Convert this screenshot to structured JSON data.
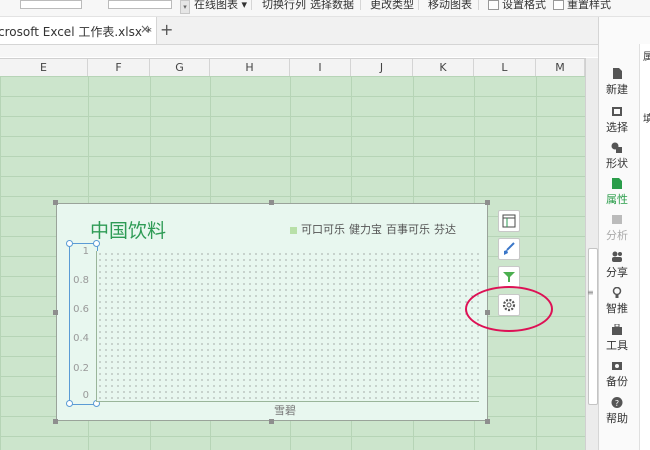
{
  "ribbon": {
    "online_chart": "在线图表",
    "switch_row_col": "切换行列",
    "select_data": "选择数据",
    "change_type": "更改类型",
    "move_chart": "移动图表",
    "set_format": "设置格式",
    "reset_style": "重置样式"
  },
  "tabs": {
    "file_title": "crosoft Excel 工作表.xlsx *",
    "close": "×",
    "add": "+"
  },
  "columns": [
    "E",
    "F",
    "G",
    "H",
    "I",
    "J",
    "K",
    "L",
    "M"
  ],
  "chart": {
    "title": "中国饮料",
    "legend": [
      "可口可乐",
      "健力宝",
      "百事可乐",
      "芬达"
    ],
    "yticks": [
      "1",
      "0.8",
      "0.6",
      "0.4",
      "0.2",
      "0"
    ],
    "xlabel": "雪碧"
  },
  "side_panel": {
    "items": [
      {
        "label": "新建",
        "icon": "new-doc-icon"
      },
      {
        "label": "选择",
        "icon": "select-icon"
      },
      {
        "label": "形状",
        "icon": "shapes-icon"
      },
      {
        "label": "属性",
        "icon": "properties-icon"
      },
      {
        "label": "分析",
        "icon": "analysis-icon"
      },
      {
        "label": "分享",
        "icon": "share-icon"
      },
      {
        "label": "智推",
        "icon": "recommend-icon"
      },
      {
        "label": "工具",
        "icon": "toolbox-icon"
      },
      {
        "label": "备份",
        "icon": "backup-icon"
      },
      {
        "label": "帮助",
        "icon": "help-icon"
      }
    ],
    "extra_label_top": "属",
    "extra_label_fill": "填"
  },
  "colors": {
    "grid_green": "#cce5cc",
    "title_green": "#2e9b55",
    "highlight_ring": "#dd1155"
  }
}
